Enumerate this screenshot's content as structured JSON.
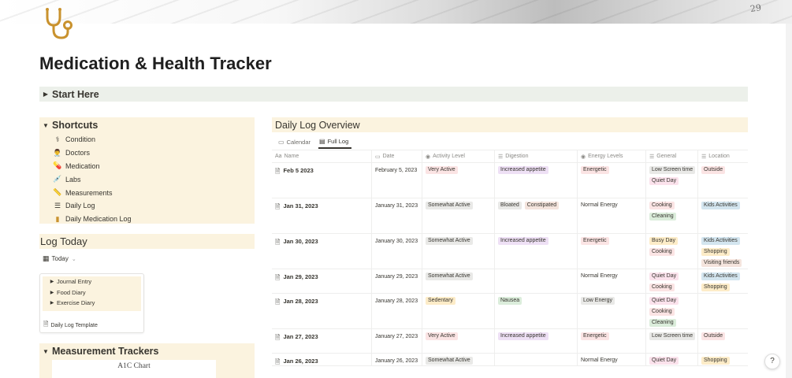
{
  "page": {
    "title": "Medication & Health Tracker",
    "icon": "stethoscope-icon",
    "banner_text": "29"
  },
  "toggles": {
    "start_here": "Start Here"
  },
  "shortcuts": {
    "heading": "Shortcuts",
    "items": [
      {
        "label": "Condition",
        "icon": "stethoscope-icon"
      },
      {
        "label": "Doctors",
        "icon": "doctor-icon"
      },
      {
        "label": "Medication",
        "icon": "pill-icon"
      },
      {
        "label": "Labs",
        "icon": "syringe-icon"
      },
      {
        "label": "Measurements",
        "icon": "ruler-icon"
      },
      {
        "label": "Daily Log",
        "icon": "list-icon"
      },
      {
        "label": "Daily Medication Log",
        "icon": "medicine-bottle-icon"
      }
    ]
  },
  "log_today": {
    "heading": "Log Today",
    "view": "Today",
    "template_items": [
      "Journal Entry",
      "Food Diary",
      "Exercise Diary"
    ],
    "template_name": "Daily Log Template"
  },
  "measurement_trackers": {
    "heading": "Measurement Trackers",
    "chart_title": "A1C Chart"
  },
  "daily_log": {
    "heading": "Daily Log Overview",
    "tabs": [
      "Calendar",
      "Full Log"
    ],
    "active_tab": "Full Log",
    "columns": [
      "Name",
      "Date",
      "Activity Level",
      "Digestion",
      "Energy Levels",
      "General",
      "Location"
    ],
    "rows": [
      {
        "name": "Feb 5 2023",
        "date": "February 5, 2023",
        "activity": [
          "Very Active"
        ],
        "digestion": [
          "Increased appetite"
        ],
        "energy": [
          "Energetic"
        ],
        "general": [
          "Low Screen time",
          "Quiet Day"
        ],
        "location": [
          "Outside"
        ]
      },
      {
        "name": "Jan 31, 2023",
        "date": "January 31, 2023",
        "activity": [
          "Somewhat Active"
        ],
        "digestion": [
          "Bloated",
          "Constipated"
        ],
        "energy": [
          "Normal Energy"
        ],
        "general": [
          "Cooking",
          "Cleaning"
        ],
        "location": [
          "Kids Activities"
        ]
      },
      {
        "name": "Jan 30, 2023",
        "date": "January 30, 2023",
        "activity": [
          "Somewhat Active"
        ],
        "digestion": [
          "Increased appetite"
        ],
        "energy": [
          "Energetic"
        ],
        "general": [
          "Busy Day",
          "Cooking"
        ],
        "location": [
          "Kids Activities",
          "Shopping",
          "Visiting friends"
        ]
      },
      {
        "name": "Jan 29, 2023",
        "date": "January 29, 2023",
        "activity": [
          "Somewhat Active"
        ],
        "digestion": [],
        "energy": [
          "Normal Energy"
        ],
        "general": [
          "Quiet Day",
          "Cooking"
        ],
        "location": [
          "Kids Activities",
          "Shopping"
        ]
      },
      {
        "name": "Jan 28, 2023",
        "date": "January 28, 2023",
        "activity": [
          "Sedentary"
        ],
        "digestion": [
          "Nausea"
        ],
        "energy": [
          "Low Energy"
        ],
        "general": [
          "Quiet Day",
          "Cooking",
          "Cleaning"
        ],
        "location": []
      },
      {
        "name": "Jan 27, 2023",
        "date": "January 27, 2023",
        "activity": [
          "Very Active"
        ],
        "digestion": [
          "Increased appetite"
        ],
        "energy": [
          "Energetic"
        ],
        "general": [
          "Low Screen time"
        ],
        "location": [
          "Outside"
        ]
      },
      {
        "name": "Jan 26, 2023",
        "date": "January 26, 2023",
        "activity": [
          "Somewhat Active"
        ],
        "digestion": [],
        "energy": [
          "Normal Energy"
        ],
        "general": [
          "Quiet Day"
        ],
        "location": [
          "Shopping"
        ]
      }
    ]
  },
  "tag_colors": {
    "Very Active": "#fbe4e4",
    "Somewhat Active": "#e9e9e7",
    "Sedentary": "#fdecc8",
    "Increased appetite": "#eee0f5",
    "Bloated": "#e9e9e7",
    "Constipated": "#f4e4dd",
    "Nausea": "#dbeddb",
    "Energetic": "#fbe4e4",
    "Normal Energy": "transparent",
    "Low Energy": "#e9e9e7",
    "Low Screen time": "#e9e9e7",
    "Quiet Day": "#fbe2ec",
    "Cooking": "#fbe4e4",
    "Cleaning": "#dbeddb",
    "Busy Day": "#fdecc8",
    "Outside": "#fbe4e4",
    "Kids Activities": "#d3e5ef",
    "Shopping": "#fdecc8",
    "Visiting friends": "#f4e4dd"
  },
  "help": "?"
}
